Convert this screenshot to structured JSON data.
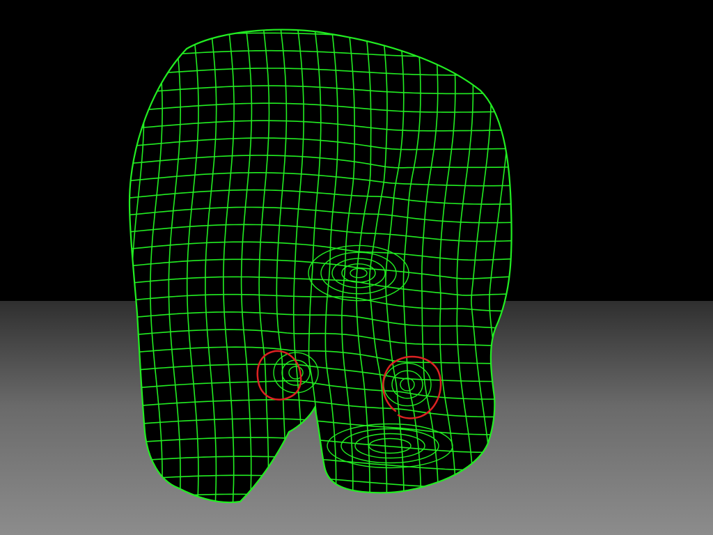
{
  "viewport": {
    "background_top": "#000000",
    "floor_gradient": [
      "#2f2f2f",
      "#6a6a6a",
      "#8c8c8c"
    ],
    "subject": "wireframe-head-mesh",
    "wire_color": "#22ee22",
    "markup_color": "#dd2222",
    "markup_count": 2
  }
}
